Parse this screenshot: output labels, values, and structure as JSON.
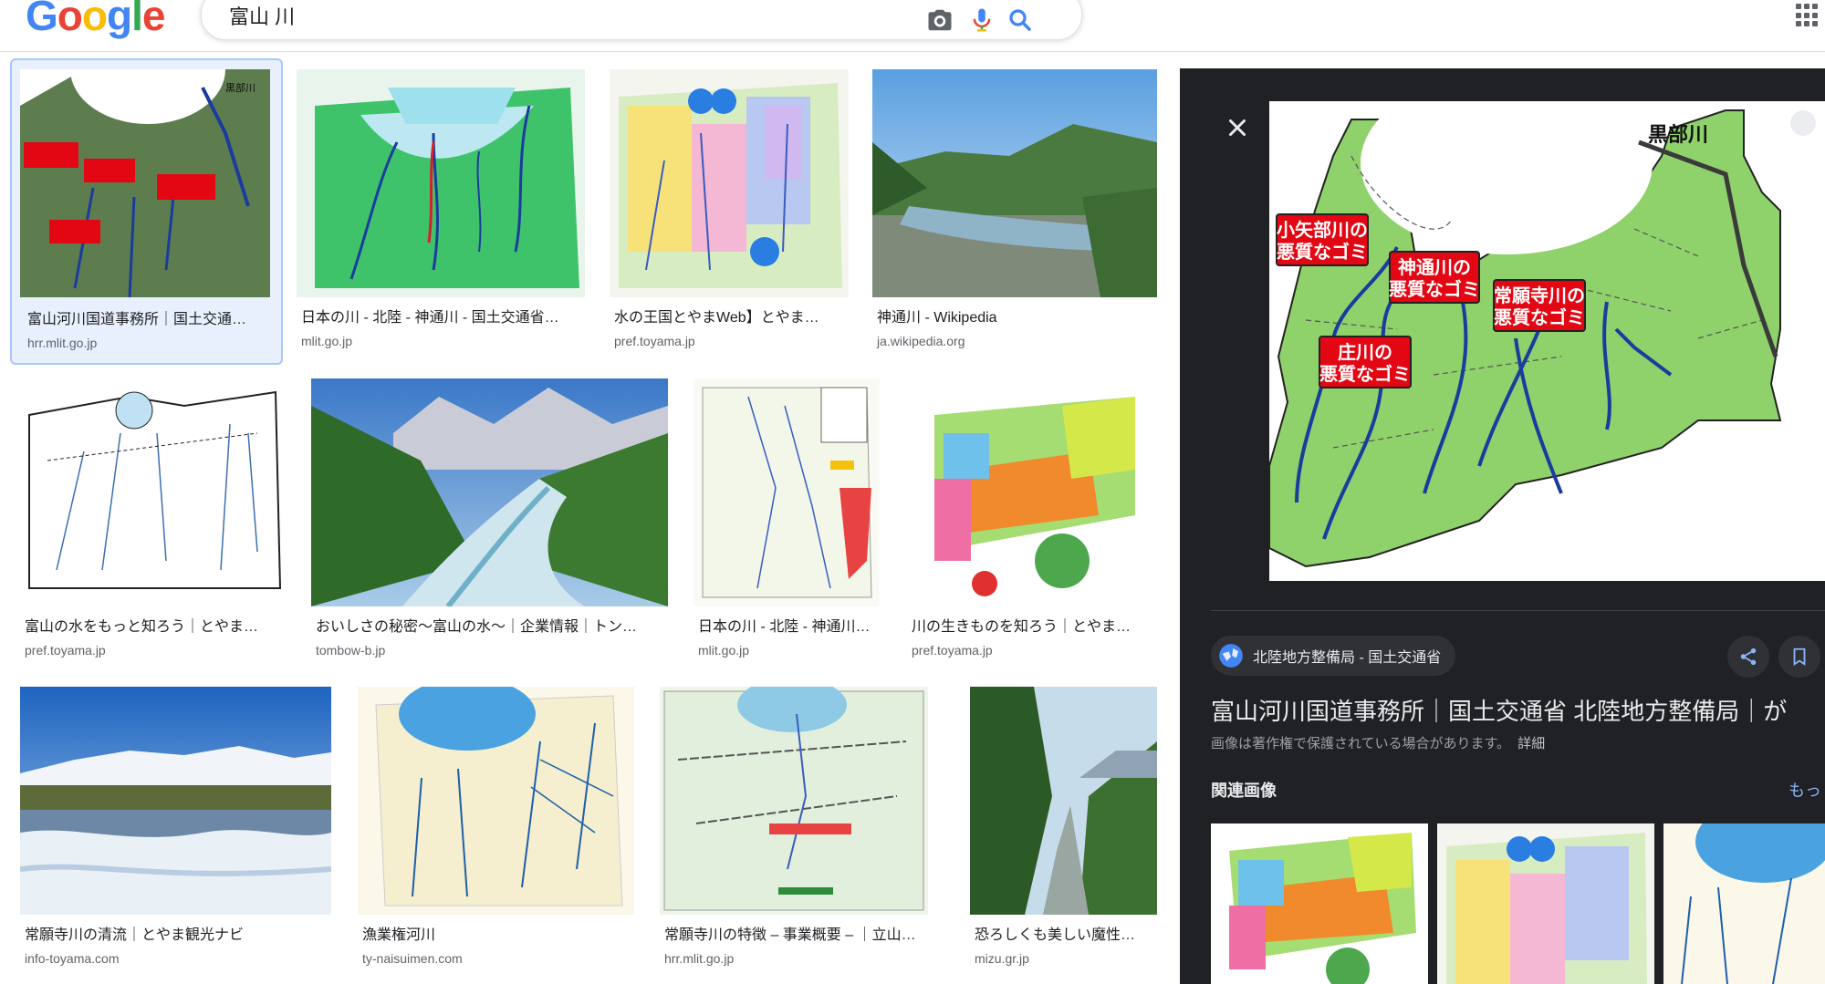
{
  "header": {
    "logo": "Google",
    "query": "富山 川",
    "icons": [
      "camera-icon",
      "mic-icon",
      "search-icon",
      "apps-icon"
    ]
  },
  "results": [
    {
      "caption": "富山河川国道事務所｜国土交通…",
      "source": "hrr.mlit.go.jp"
    },
    {
      "caption": "日本の川 - 北陸 - 神通川 - 国土交通省…",
      "source": "mlit.go.jp"
    },
    {
      "caption": "水の王国とやまWeb】とやま…",
      "source": "pref.toyama.jp"
    },
    {
      "caption": "神通川 - Wikipedia",
      "source": "ja.wikipedia.org"
    },
    {
      "caption": "富山の水をもっと知ろう｜とやま…",
      "source": "pref.toyama.jp"
    },
    {
      "caption": "おいしさの秘密〜富山の水〜｜企業情報｜トン…",
      "source": "tombow-b.jp"
    },
    {
      "caption": "日本の川 - 北陸 - 神通川…",
      "source": "mlit.go.jp"
    },
    {
      "caption": "川の生きものを知ろう｜とやま…",
      "source": "pref.toyama.jp"
    },
    {
      "caption": "常願寺川の清流｜とやま観光ナビ",
      "source": "info-toyama.com"
    },
    {
      "caption": "漁業権河川",
      "source": "ty-naisuimen.com"
    },
    {
      "caption": "常願寺川の特徴 – 事業概要 – ｜立山…",
      "source": "hrr.mlit.go.jp"
    },
    {
      "caption": "恐ろしくも美しい魔性…",
      "source": "mizu.gr.jp"
    }
  ],
  "map_labels": {
    "kurobe": "黒部川",
    "oyabe": [
      "小矢部川の",
      "悪質なゴミ"
    ],
    "jinzu": [
      "神通川の",
      "悪質なゴミ"
    ],
    "joganji": [
      "常願寺川の",
      "悪質なゴミ"
    ],
    "sho": [
      "庄川の",
      "悪質なゴミ"
    ]
  },
  "preview": {
    "source_chip": "北陸地方整備局 - 国土交通省",
    "title": "富山河川国道事務所｜国土交通省 北陸地方整備局｜が",
    "copyright": "画像は著作権で保護されている場合があります。",
    "details_link": "詳細",
    "related_heading": "関連画像",
    "more_link": "もっ"
  },
  "colors": {
    "map_green": "#8fd16b",
    "river_blue": "#1b3c9e",
    "label_red": "#e30613",
    "panel_bg": "#202124",
    "link_blue": "#8ab4f8"
  }
}
